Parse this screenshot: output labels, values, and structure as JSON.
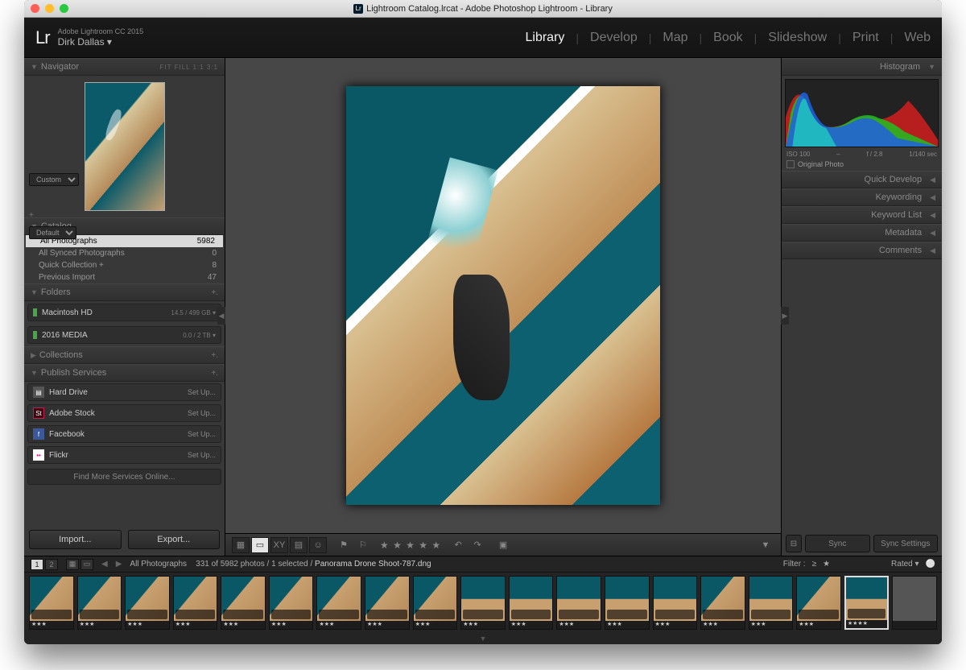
{
  "window": {
    "title": "Lightroom Catalog.lrcat - Adobe Photoshop Lightroom - Library",
    "traffic": [
      "close",
      "minimize",
      "zoom"
    ]
  },
  "identity": {
    "logo": "Lr",
    "product": "Adobe Lightroom CC 2015",
    "user": "Dirk Dallas"
  },
  "modules": {
    "items": [
      "Library",
      "Develop",
      "Map",
      "Book",
      "Slideshow",
      "Print",
      "Web"
    ],
    "active": "Library"
  },
  "left": {
    "navigator": {
      "title": "Navigator",
      "opts": "FIT   FILL   1:1   3:1"
    },
    "catalog": {
      "title": "Catalog",
      "items": [
        {
          "label": "All Photographs",
          "count": "5982",
          "selected": true
        },
        {
          "label": "All Synced Photographs",
          "count": "0"
        },
        {
          "label": "Quick Collection  +",
          "count": "8"
        },
        {
          "label": "Previous Import",
          "count": "47"
        }
      ]
    },
    "folders": {
      "title": "Folders",
      "items": [
        {
          "label": "Macintosh HD",
          "size": "14.5 / 499 GB",
          "chev": true
        },
        {
          "label": "2016 MEDIA",
          "size": "0.0 / 2 TB",
          "chev": true
        }
      ]
    },
    "collections": {
      "title": "Collections"
    },
    "publish": {
      "title": "Publish Services",
      "items": [
        {
          "icon": "hd",
          "label": "Hard Drive",
          "action": "Set Up..."
        },
        {
          "icon": "st",
          "label": "Adobe Stock",
          "action": "Set Up..."
        },
        {
          "icon": "fb",
          "label": "Facebook",
          "action": "Set Up..."
        },
        {
          "icon": "fl",
          "label": "Flickr",
          "action": "Set Up..."
        }
      ],
      "find_more": "Find More Services Online..."
    },
    "buttons": {
      "import": "Import...",
      "export": "Export..."
    }
  },
  "right": {
    "histogram": {
      "title": "Histogram",
      "iso": "ISO 100",
      "dash": "–",
      "aperture": "f / 2.8",
      "shutter": "1/140 sec",
      "check": "Original Photo"
    },
    "quick_develop": {
      "title": "Quick Develop",
      "preset": "Custom"
    },
    "keywording": {
      "title": "Keywording"
    },
    "keyword_list": {
      "title": "Keyword List"
    },
    "metadata": {
      "title": "Metadata",
      "preset": "Default"
    },
    "comments": {
      "title": "Comments"
    },
    "sync": "Sync",
    "sync_settings": "Sync Settings"
  },
  "toolbar": {
    "stars": "★ ★ ★ ★ ★"
  },
  "filmstrip": {
    "source": "All Photographs",
    "counts": "331 of 5982 photos / 1 selected /",
    "filename": "Panorama Drone Shoot-787.dng",
    "filter_label": "Filter :",
    "filter_op": "≥",
    "filter_star": "★",
    "rated": "Rated"
  }
}
